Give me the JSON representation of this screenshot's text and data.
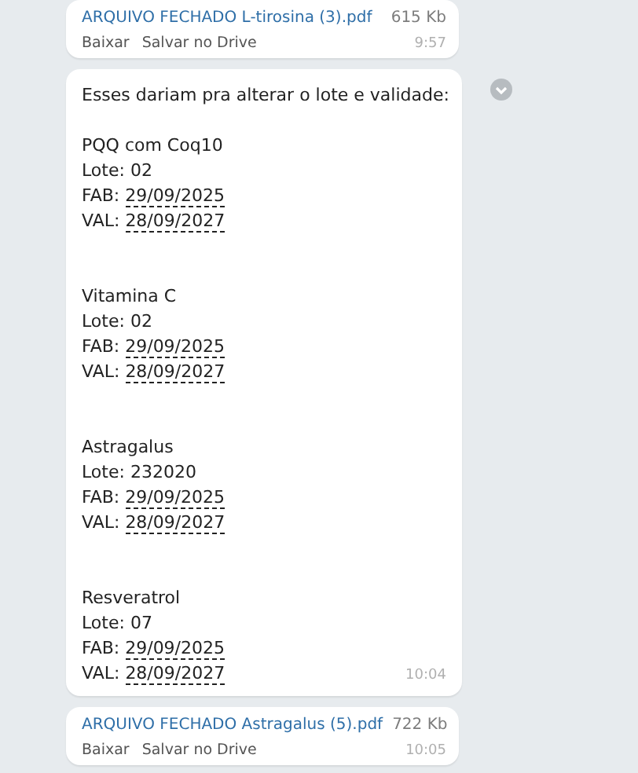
{
  "messages": [
    {
      "kind": "file",
      "file_name": "ARQUIVO FECHADO L-tirosina (3).pdf",
      "size": "615 Kb",
      "actions": [
        "Baixar",
        "Salvar no Drive"
      ],
      "time": "9:57"
    },
    {
      "kind": "text",
      "intro": "Esses dariam pra alterar o lote e validade:",
      "products": [
        {
          "name": "PQQ com Coq10",
          "lote": "Lote: 02",
          "fab_label": "FAB:",
          "fab": "29/09/2025",
          "val_label": "VAL:",
          "val": "28/09/2027"
        },
        {
          "name": "Vitamina C",
          "lote": "Lote: 02",
          "fab_label": "FAB:",
          "fab": "29/09/2025",
          "val_label": "VAL:",
          "val": "28/09/2027"
        },
        {
          "name": "Astragalus",
          "lote": "Lote: 232020",
          "fab_label": "FAB:",
          "fab": "29/09/2025",
          "val_label": "VAL:",
          "val": "28/09/2027"
        },
        {
          "name": "Resveratrol",
          "lote": "Lote: 07",
          "fab_label": "FAB:",
          "fab": "29/09/2025",
          "val_label": "VAL:",
          "val": "28/09/2027"
        }
      ],
      "time": "10:04"
    },
    {
      "kind": "file",
      "file_name": "ARQUIVO FECHADO Astragalus (5).pdf",
      "size": "722 Kb",
      "actions": [
        "Baixar",
        "Salvar no Drive"
      ],
      "time": "10:05"
    }
  ]
}
